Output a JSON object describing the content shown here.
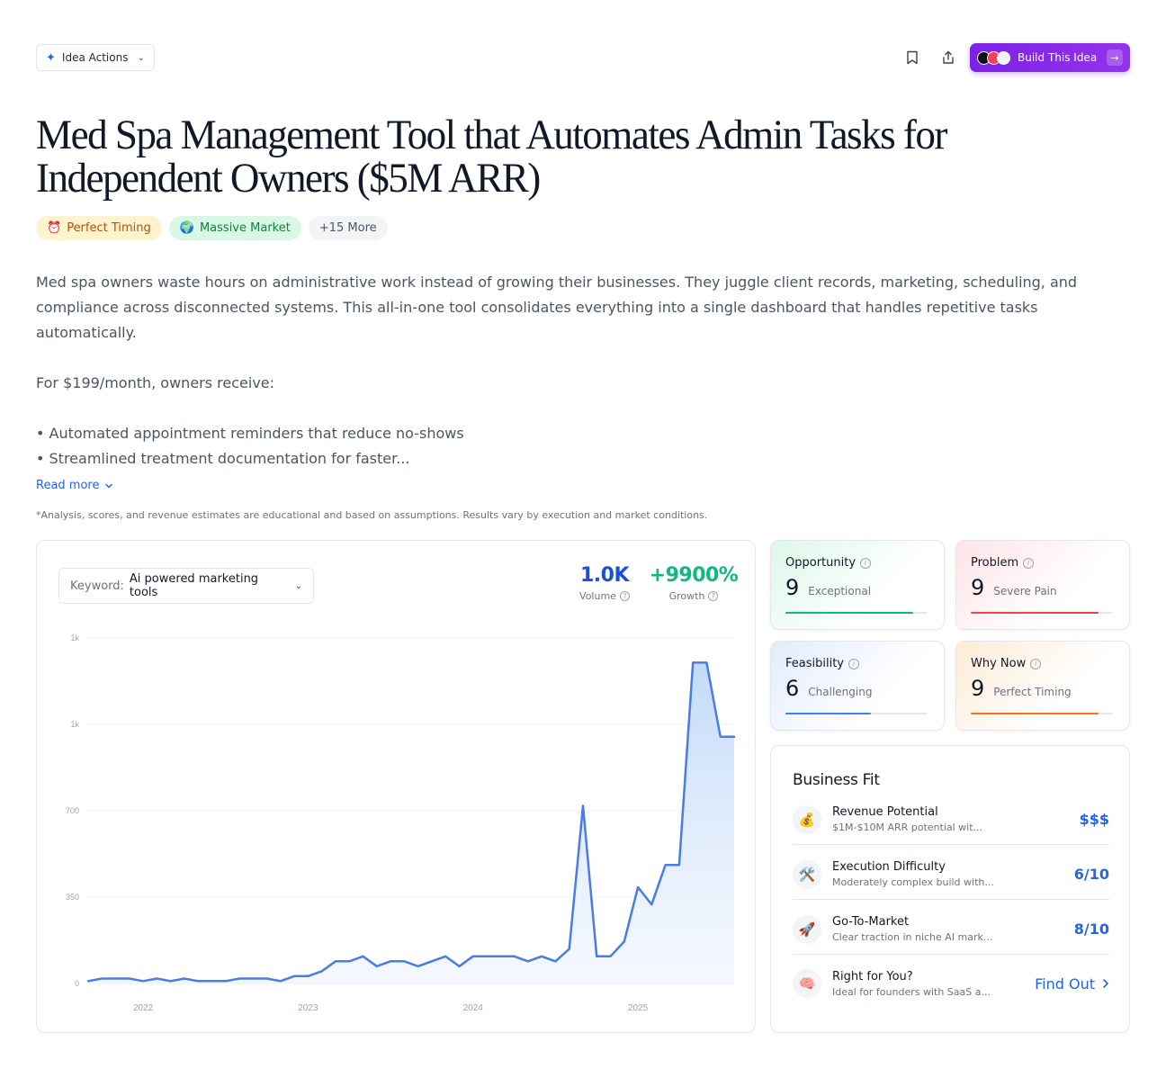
{
  "toolbar": {
    "idea_actions": "Idea Actions",
    "build_label": "Build This Idea"
  },
  "title": "Med Spa Management Tool that Automates Admin Tasks for Independent Owners ($5M ARR)",
  "tags": [
    {
      "icon": "⏰",
      "label": "Perfect Timing"
    },
    {
      "icon": "🌍",
      "label": "Massive Market"
    },
    {
      "icon": "",
      "label": "+15 More"
    }
  ],
  "description": {
    "p1": "Med spa owners waste hours on administrative work instead of growing their businesses. They juggle client records, marketing, scheduling, and compliance across disconnected systems. This all-in-one tool consolidates everything into a single dashboard that handles repetitive tasks automatically.",
    "p2": "For $199/month, owners receive:",
    "b1": "• Automated appointment reminders that reduce no-shows",
    "b2": "• Streamlined treatment documentation for faster..."
  },
  "read_more": "Read more",
  "disclaimer": "*Analysis, scores, and revenue estimates are educational and based on assumptions. Results vary by execution and market conditions.",
  "keyword": {
    "label": "Keyword:",
    "value": "Ai powered marketing tools"
  },
  "stats": {
    "volume_value": "1.0K",
    "volume_label": "Volume",
    "growth_value": "+9900%",
    "growth_label": "Growth"
  },
  "chart_data": {
    "type": "area",
    "y_tick_labels": [
      "0",
      "350",
      "700",
      "1k",
      "1k"
    ],
    "y_ticks": [
      0,
      350,
      700,
      1050,
      1400
    ],
    "ylim": [
      0,
      1400
    ],
    "x_tick_labels": [
      "2022",
      "2023",
      "2024",
      "2025"
    ],
    "x_tick_index": [
      4,
      16,
      28,
      40
    ],
    "grid": true,
    "color": "#4a7ce5",
    "values": [
      10,
      20,
      20,
      20,
      10,
      20,
      10,
      20,
      10,
      10,
      10,
      20,
      20,
      20,
      10,
      30,
      30,
      50,
      90,
      90,
      110,
      70,
      90,
      90,
      70,
      90,
      110,
      70,
      110,
      110,
      110,
      110,
      90,
      110,
      90,
      140,
      720,
      110,
      110,
      170,
      390,
      320,
      480,
      480,
      1300,
      1300,
      1000,
      1000
    ]
  },
  "scores": [
    {
      "title": "Opportunity",
      "score": "9",
      "label": "Exceptional",
      "fill": 0.9,
      "color": "#10b981"
    },
    {
      "title": "Problem",
      "score": "9",
      "label": "Severe Pain",
      "fill": 0.9,
      "color": "#ef4444"
    },
    {
      "title": "Feasibility",
      "score": "6",
      "label": "Challenging",
      "fill": 0.6,
      "color": "#3b82f6"
    },
    {
      "title": "Why Now",
      "score": "9",
      "label": "Perfect Timing",
      "fill": 0.9,
      "color": "#f97316"
    }
  ],
  "business_fit": {
    "title": "Business Fit",
    "rows": [
      {
        "icon": "💰",
        "name": "Revenue Potential",
        "sub": "$1M-$10M ARR potential wit...",
        "value": "$$$"
      },
      {
        "icon": "🛠️",
        "name": "Execution Difficulty",
        "sub": "Moderately complex build with...",
        "value": "6/10"
      },
      {
        "icon": "🚀",
        "name": "Go-To-Market",
        "sub": "Clear traction in niche AI mark...",
        "value": "8/10"
      },
      {
        "icon": "🧠",
        "name": "Right for You?",
        "sub": "Ideal for founders with SaaS a...",
        "value": "Find Out"
      }
    ]
  }
}
